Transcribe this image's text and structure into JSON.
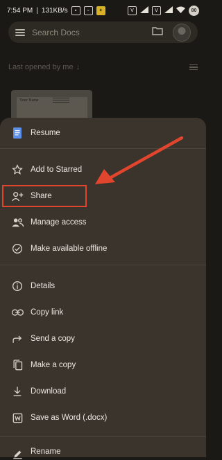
{
  "status_bar": {
    "time": "7:54 PM",
    "network_speed": "131KB/s",
    "battery": "80"
  },
  "search": {
    "placeholder": "Search Docs"
  },
  "list_header": {
    "sort_label": "Last opened by me"
  },
  "thumbnail": {
    "title": "Your Name"
  },
  "menu": {
    "items": [
      {
        "label": "Resume",
        "icon": "docs-icon"
      },
      {
        "label": "Add to Starred",
        "icon": "star-icon"
      },
      {
        "label": "Share",
        "icon": "person-add-icon"
      },
      {
        "label": "Manage access",
        "icon": "people-icon"
      },
      {
        "label": "Make available offline",
        "icon": "offline-check-icon"
      },
      {
        "label": "Details",
        "icon": "info-icon"
      },
      {
        "label": "Copy link",
        "icon": "link-icon"
      },
      {
        "label": "Send a copy",
        "icon": "forward-icon"
      },
      {
        "label": "Make a copy",
        "icon": "copy-icon"
      },
      {
        "label": "Download",
        "icon": "download-icon"
      },
      {
        "label": "Save as Word (.docx)",
        "icon": "word-icon"
      },
      {
        "label": "Rename",
        "icon": "edit-icon"
      }
    ]
  },
  "colors": {
    "annotation": "#e2452d",
    "sheet_background": "#3b342c",
    "docs_blue": "#5b8fe8"
  }
}
